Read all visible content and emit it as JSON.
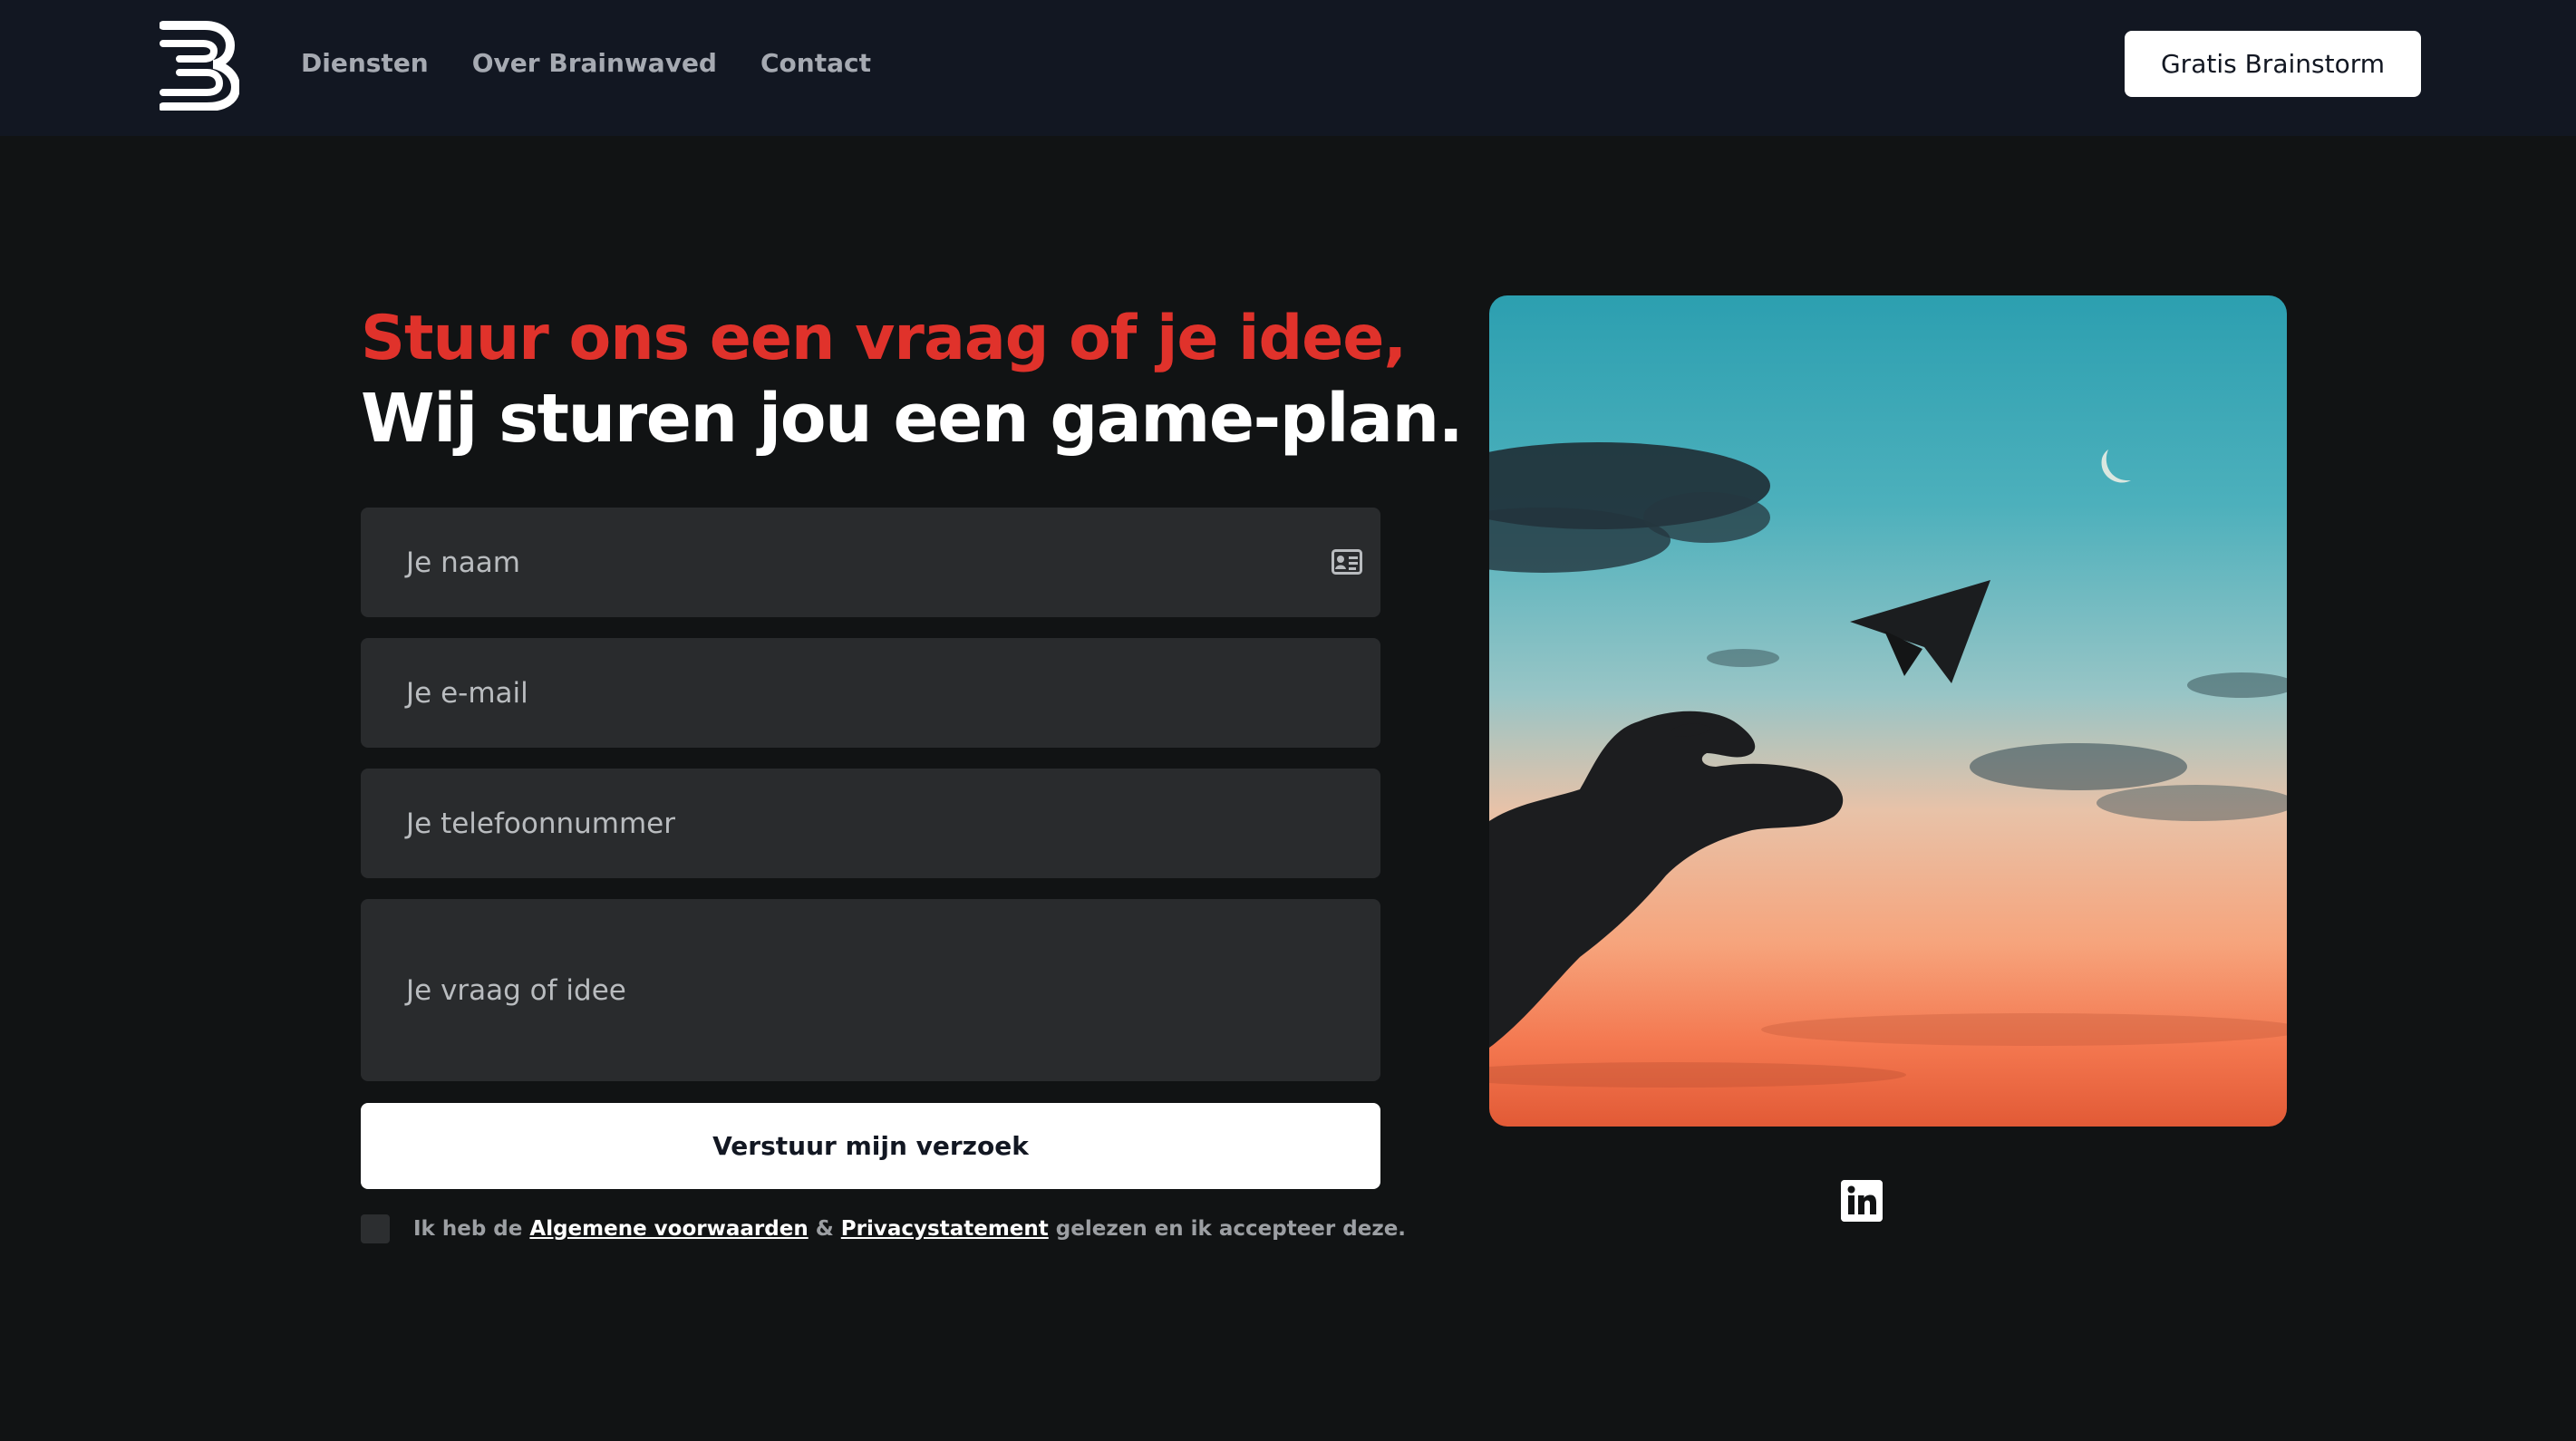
{
  "header": {
    "nav": [
      "Diensten",
      "Over Brainwaved",
      "Contact"
    ],
    "cta_label": "Gratis Brainstorm"
  },
  "hero": {
    "headline_line1": "Stuur ons een vraag of je idee,",
    "headline_line2": "Wij sturen jou een game-plan."
  },
  "form": {
    "name_placeholder": "Je naam",
    "email_placeholder": "Je e-mail",
    "phone_placeholder": "Je telefoonnummer",
    "message_placeholder": "Je vraag of idee",
    "submit_label": "Verstuur mijn verzoek",
    "consent": {
      "prefix": "Ik heb de",
      "terms_link": "Algemene voorwaarden",
      "amp": "&",
      "privacy_link": "Privacystatement",
      "suffix": "gelezen en ik accepteer deze."
    }
  },
  "icons": {
    "logo": "brainwaved-logo",
    "contact_card": "contact-card-icon",
    "linkedin": "linkedin-icon"
  },
  "colors": {
    "accent_red": "#e0322b",
    "header_bg": "#121722",
    "page_bg": "#111314",
    "field_bg": "#292b2d"
  }
}
